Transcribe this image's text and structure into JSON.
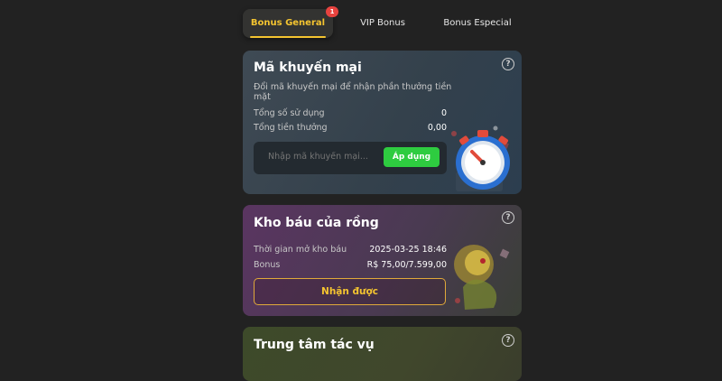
{
  "tabs": [
    {
      "label": "Bonus General",
      "active": true,
      "badge": "1"
    },
    {
      "label": "VIP Bonus",
      "active": false
    },
    {
      "label": "Bonus Especial",
      "active": false
    }
  ],
  "promo_card": {
    "title": "Mã khuyến mại",
    "description": "Đổi mã khuyến mại để nhận phần thưởng tiền mặt",
    "rows": [
      {
        "label": "Tổng số sử dụng",
        "value": "0"
      },
      {
        "label": "Tổng tiền thưởng",
        "value": "0,00"
      }
    ],
    "input_placeholder": "Nhập mã khuyến mại...",
    "apply_label": "Áp dụng",
    "help": "?"
  },
  "dragon_card": {
    "title": "Kho báu của rồng",
    "rows": [
      {
        "label": "Thời gian mở kho báu",
        "value": "2025-03-25 18:46"
      },
      {
        "label": "Bonus",
        "value": "R$ 75,00/7.599,00"
      }
    ],
    "claim_label": "Nhận được",
    "help": "?"
  },
  "tasks_card": {
    "title": "Trung tâm tác vụ",
    "help": "?"
  },
  "colors": {
    "background": "#222222",
    "accent_gold": "#f4c430",
    "apply_green": "#2ecc40",
    "badge_red": "#e8433f"
  }
}
